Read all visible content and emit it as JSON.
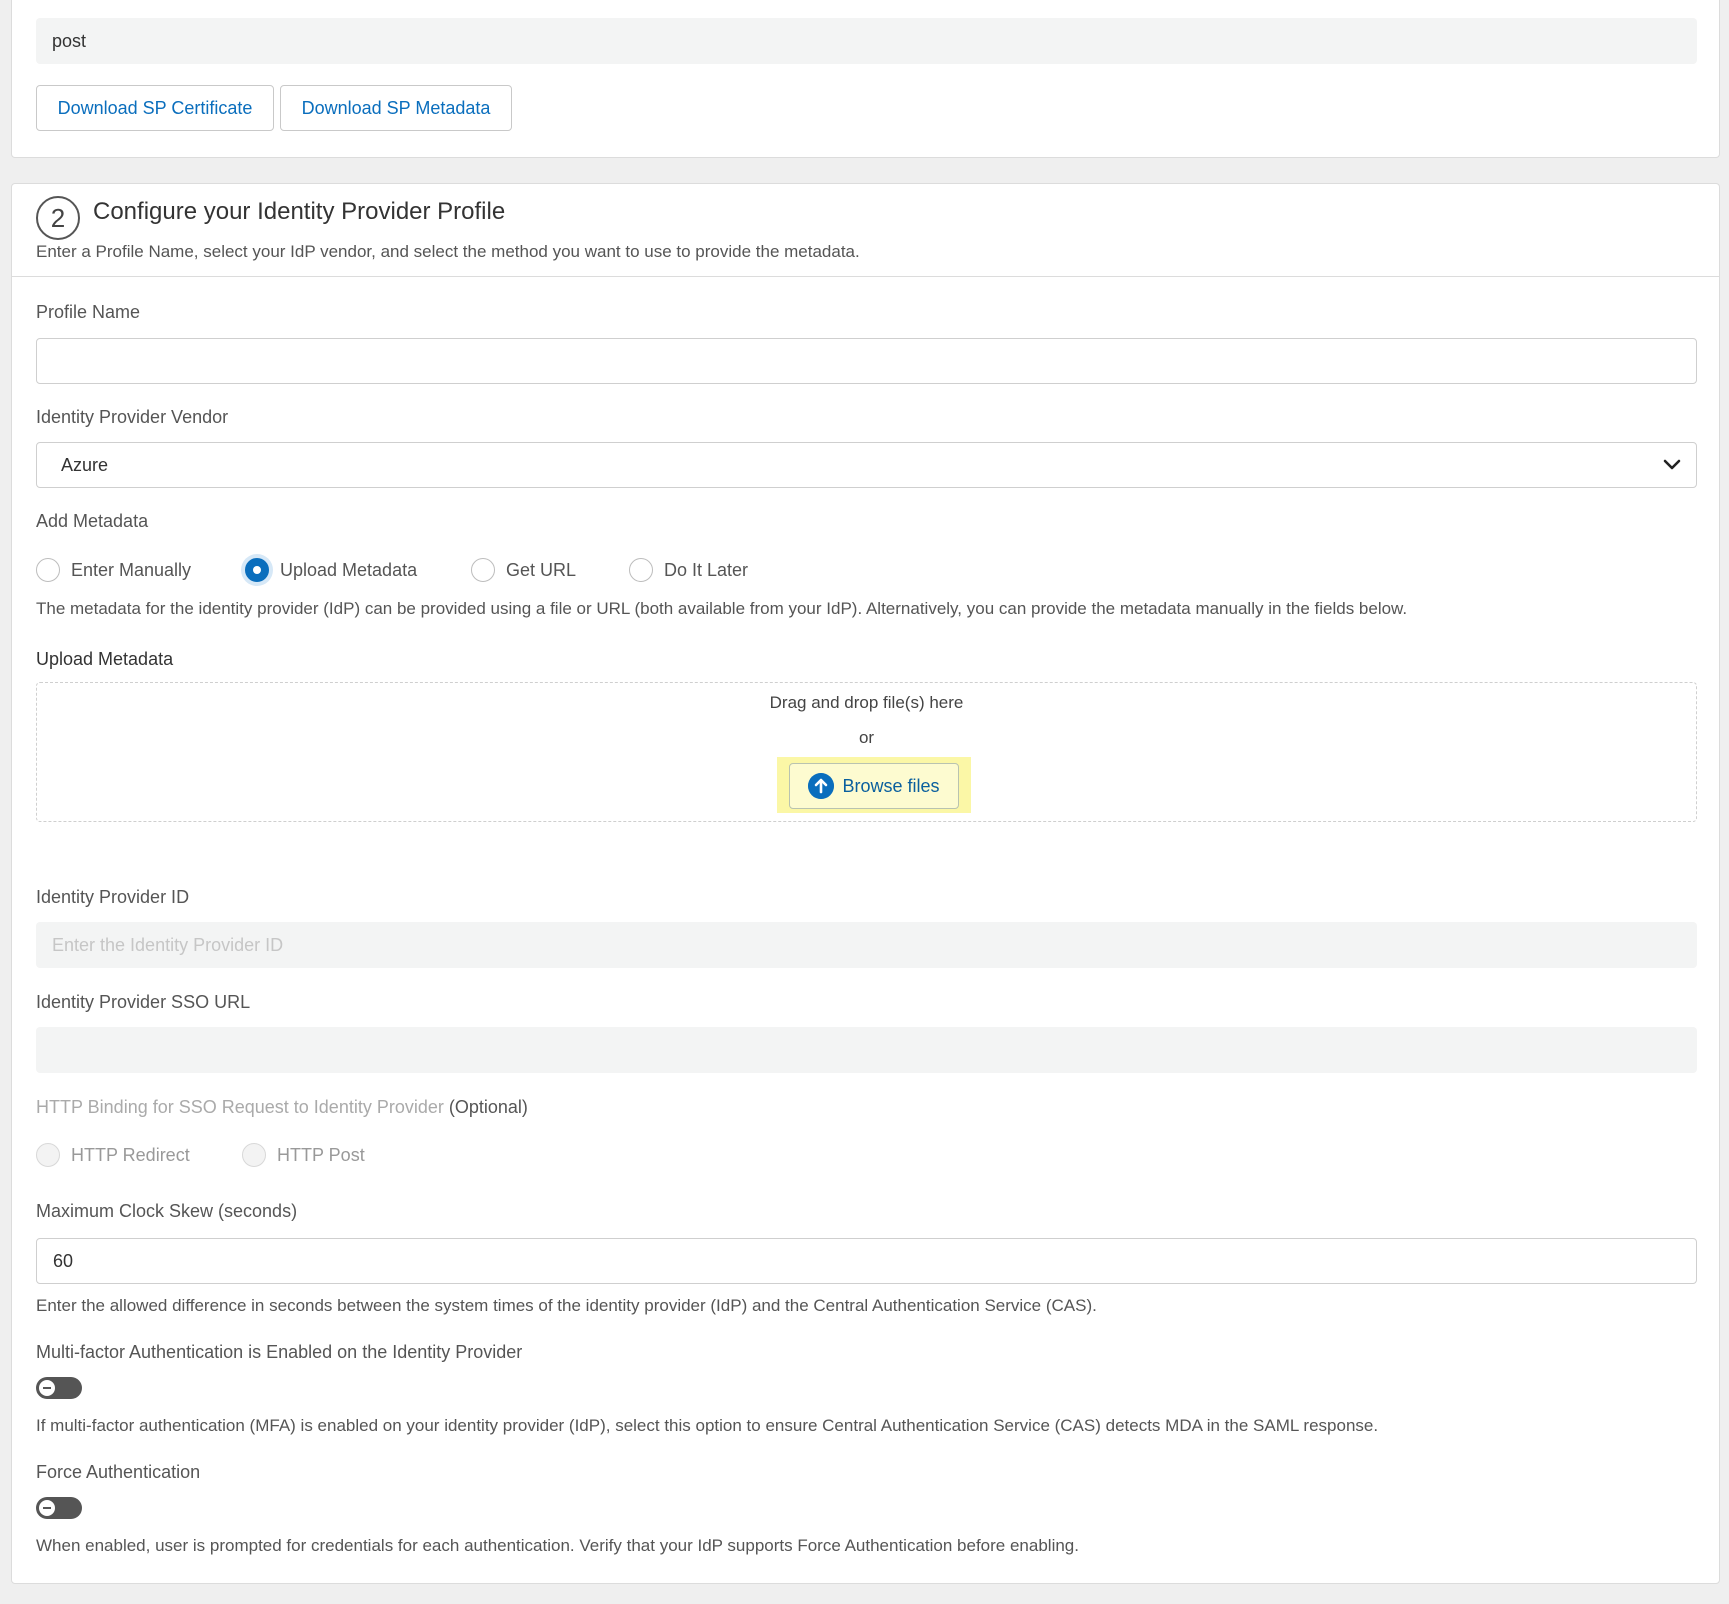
{
  "sp_section": {
    "binding_value": "post",
    "download_certificate_label": "Download SP Certificate",
    "download_metadata_label": "Download SP Metadata"
  },
  "idp_section": {
    "step_number": "2",
    "title": "Configure your Identity Provider Profile",
    "description": "Enter a Profile Name, select your IdP vendor, and select the method you want to use to provide the metadata.",
    "profile_name": {
      "label": "Profile Name",
      "value": ""
    },
    "vendor": {
      "label": "Identity Provider Vendor",
      "selected": "Azure"
    },
    "add_metadata": {
      "label": "Add Metadata",
      "options": [
        "Enter Manually",
        "Upload Metadata",
        "Get URL",
        "Do It Later"
      ],
      "selected": "Upload Metadata",
      "help": "The metadata for the identity provider (IdP) can be provided using a file or URL (both available from your IdP). Alternatively, you can provide the metadata manually in the fields below."
    },
    "upload": {
      "label": "Upload Metadata",
      "drag_text": "Drag and drop file(s) here",
      "or_text": "or",
      "browse_label": "Browse files"
    },
    "idp_id": {
      "label": "Identity Provider ID",
      "placeholder": "Enter the Identity Provider ID"
    },
    "sso_url": {
      "label": "Identity Provider SSO URL",
      "value": ""
    },
    "http_binding": {
      "label": "HTTP Binding for SSO Request to Identity Provider",
      "optional": "(Optional)",
      "options": [
        "HTTP Redirect",
        "HTTP Post"
      ]
    },
    "clock_skew": {
      "label": "Maximum Clock Skew (seconds)",
      "value": "60",
      "help": "Enter the allowed difference in seconds between the system times of the identity provider (IdP) and the Central Authentication Service (CAS)."
    },
    "mfa": {
      "label": "Multi-factor Authentication is Enabled on the Identity Provider",
      "enabled": false,
      "help": "If multi-factor authentication (MFA) is enabled on your identity provider (IdP), select this option to ensure Central Authentication Service (CAS) detects MDA in the SAML response."
    },
    "force_auth": {
      "label": "Force Authentication",
      "enabled": false,
      "help": "When enabled, user is prompted for credentials for each authentication. Verify that your IdP supports Force Authentication before enabling."
    }
  },
  "colors": {
    "accent": "#0a6ebd",
    "highlight": "#fbf7a6",
    "toggle_off": "#555555"
  }
}
